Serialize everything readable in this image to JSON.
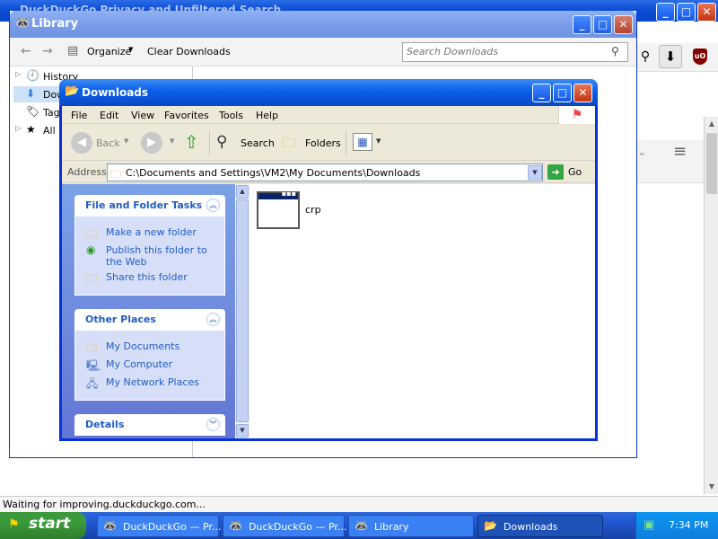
{
  "browser": {
    "title": "DuckDuckGo Privacy and Unfiltered Search",
    "status": "Waiting for improving.duckduckgo.com...",
    "controls": {
      "minimize": "_",
      "maximize": "□",
      "close": "✕"
    }
  },
  "library": {
    "title": "Library",
    "organize_label": "Organize",
    "clear_downloads_label": "Clear Downloads",
    "search_placeholder": "Search Downloads",
    "sidebar": [
      {
        "label": "History",
        "icon": "clock-icon"
      },
      {
        "label": "Downloads",
        "icon": "download-arrow-icon"
      },
      {
        "label": "Tags",
        "icon": "tag-icon"
      },
      {
        "label": "All Bookmarks",
        "icon": "star-icon"
      }
    ]
  },
  "explorer": {
    "title": "Downloads",
    "menu": [
      "File",
      "Edit",
      "View",
      "Favorites",
      "Tools",
      "Help"
    ],
    "toolbar": {
      "back": "Back",
      "search": "Search",
      "folders": "Folders"
    },
    "address_label": "Address",
    "address_value": "C:\\Documents and Settings\\VM2\\My Documents\\Downloads",
    "go_label": "Go",
    "file_tasks": {
      "title": "File and Folder Tasks",
      "items": [
        "Make a new folder",
        "Publish this folder to the Web",
        "Share this folder"
      ]
    },
    "other_places": {
      "title": "Other Places",
      "items": [
        "My Documents",
        "My Computer",
        "My Network Places"
      ]
    },
    "details": {
      "title": "Details"
    },
    "files": [
      {
        "name": "crp"
      }
    ]
  },
  "taskbar": {
    "start_label": "start",
    "buttons": [
      {
        "label": "DuckDuckGo — Pr...",
        "active": false
      },
      {
        "label": "DuckDuckGo — Pr...",
        "active": false
      },
      {
        "label": "Library",
        "active": false
      },
      {
        "label": "Downloads",
        "active": true
      }
    ],
    "clock": "7:34 PM"
  }
}
